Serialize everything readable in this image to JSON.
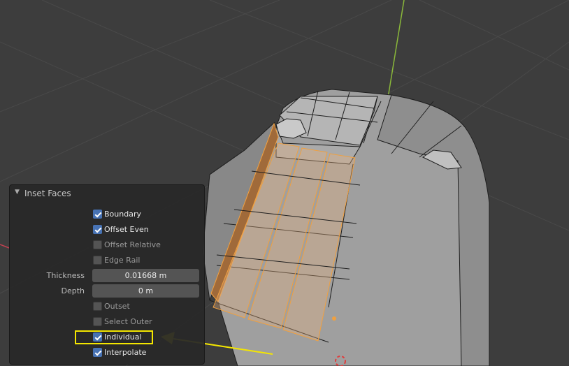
{
  "operator_panel": {
    "title": "Inset Faces",
    "options": [
      {
        "label": "Boundary",
        "checked": true
      },
      {
        "label": "Offset Even",
        "checked": true
      },
      {
        "label": "Offset Relative",
        "checked": false
      },
      {
        "label": "Edge Rail",
        "checked": false
      }
    ],
    "thickness": {
      "label": "Thickness",
      "value": "0.01668 m"
    },
    "depth": {
      "label": "Depth",
      "value": "0 m"
    },
    "options2": [
      {
        "label": "Outset",
        "checked": false
      },
      {
        "label": "Select Outer",
        "checked": false
      },
      {
        "label": "Individual",
        "checked": true
      },
      {
        "label": "Interpolate",
        "checked": true
      }
    ]
  },
  "colors": {
    "background": "#3d3d3d",
    "grid": "#4a4a4a",
    "mesh_face": "#a5a5a5",
    "selected_edge": "#f0a040",
    "annotation": "#f4e600",
    "y_axis": "#8ab83a",
    "x_axis": "#c04050"
  }
}
